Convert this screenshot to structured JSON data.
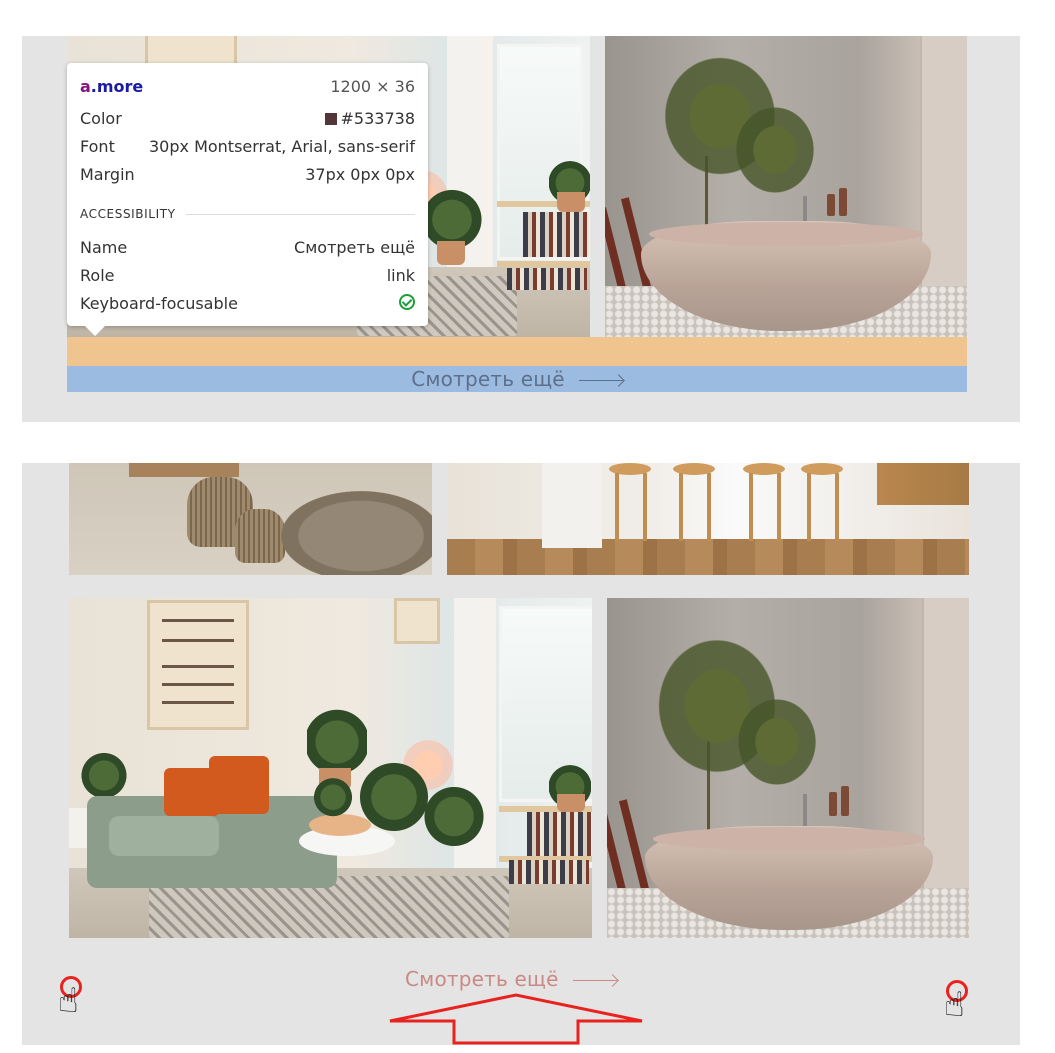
{
  "tooltip": {
    "selector_tag": "a",
    "selector_class": ".more",
    "dimensions": "1200 × 36",
    "color_label": "Color",
    "color_value": "#533738",
    "font_label": "Font",
    "font_value": "30px Montserrat, Arial, sans-serif",
    "margin_label": "Margin",
    "margin_value": "37px 0px 0px",
    "section_title": "ACCESSIBILITY",
    "name_label": "Name",
    "name_value": "Смотреть ещё",
    "role_label": "Role",
    "role_value": "link",
    "keyboard_label": "Keyboard-focusable",
    "keyboard_icon": "check-circle-icon"
  },
  "top_panel": {
    "link_text": "Смотреть ещё"
  },
  "bottom_panel": {
    "link_text": "Смотреть ещё"
  },
  "annotations": {
    "marker_icon": "hand-pointer-icon",
    "arrow_icon": "red-arrow-icon"
  },
  "colors": {
    "margin_highlight": "#f0c48f",
    "content_highlight": "#9cbbe0",
    "link_color": "#533738",
    "marker_red": "#e8231f"
  }
}
